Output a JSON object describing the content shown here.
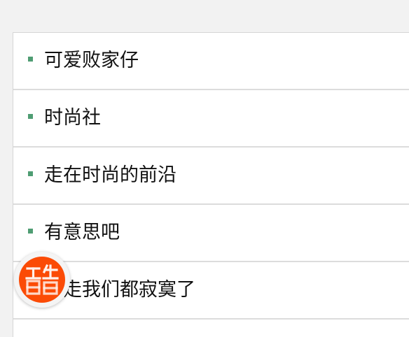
{
  "list": {
    "items": [
      {
        "label": "可爱败家仔"
      },
      {
        "label": "时尚社"
      },
      {
        "label": "走在时尚的前沿"
      },
      {
        "label": "有意思吧"
      },
      {
        "label": "别走我们都寂寞了"
      }
    ]
  },
  "colors": {
    "bullet": "#4f9d73",
    "badge": "#fb4b06",
    "divider": "#dcdcdc"
  },
  "badge": {
    "icon": "ku-logo-icon"
  }
}
